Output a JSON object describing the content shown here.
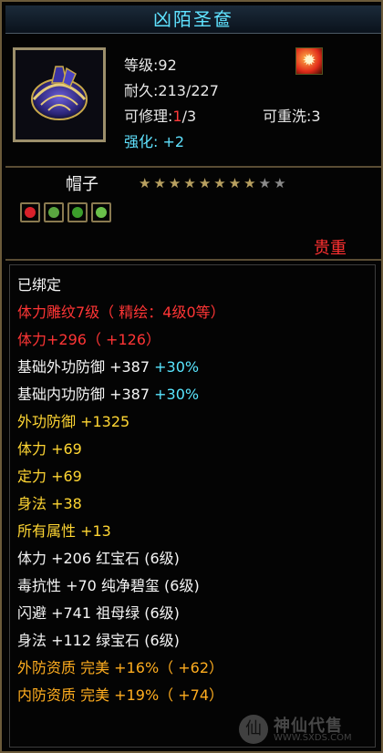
{
  "item": {
    "name": "凶陌圣奩",
    "level_label": "等级",
    "level_value": "92",
    "durability_label": "耐久",
    "durability_value": "213/227",
    "repair_label": "可修理",
    "repair_used": "1",
    "repair_total": "/3",
    "rewash_label": "可重洗",
    "rewash_value": "3",
    "strengthen_label": "强化",
    "strengthen_value": "+2",
    "type": "帽子",
    "stars_filled": 8,
    "stars_total": 10,
    "rarity": "贵重",
    "icon": "helmet-icon",
    "badge_icon": "fire-charm-icon",
    "gem_slots": [
      "ruby-gem-icon",
      "jade-gem-icon",
      "emerald-gem-icon",
      "green-gem-icon"
    ]
  },
  "lines": [
    {
      "label": "已绑定",
      "color": "white"
    },
    {
      "label": "体力雕纹7级（ 精绘：4级0等）",
      "color": "red"
    },
    {
      "label": "体力+296（ +126）",
      "color": "red"
    },
    {
      "label": "基础外功防御 +387",
      "extra": "+30%",
      "color": "white"
    },
    {
      "label": "基础内功防御 +387",
      "extra": "+30%",
      "color": "white"
    },
    {
      "label": "外功防御 +1325",
      "color": "yellow"
    },
    {
      "label": "体力 +69",
      "color": "yellow"
    },
    {
      "label": "定力 +69",
      "color": "yellow"
    },
    {
      "label": "身法 +38",
      "color": "yellow"
    },
    {
      "label": "所有属性 +13",
      "color": "yellow"
    },
    {
      "label": "体力 +206  红宝石 (6级)",
      "color": "white"
    },
    {
      "label": "毒抗性 +70  纯净碧玺 (6级)",
      "color": "white"
    },
    {
      "label": "闪避 +741  祖母绿 (6级)",
      "color": "white"
    },
    {
      "label": "身法 +112  绿宝石 (6级)",
      "color": "white"
    },
    {
      "label": "外防资质   完美 +16%（ +62）",
      "color": "orange"
    },
    {
      "label": "内防资质   完美 +19%（ +74）",
      "color": "orange"
    }
  ],
  "watermark": {
    "text": "神仙代售",
    "url": "WWW.SXDS.COM"
  },
  "colors": {
    "title": "#5fe2ff",
    "red": "#ff3535",
    "yellow": "#ffd633",
    "orange": "#ffad1f",
    "cyan": "#59e6ff",
    "border": "#6b5a3a"
  }
}
